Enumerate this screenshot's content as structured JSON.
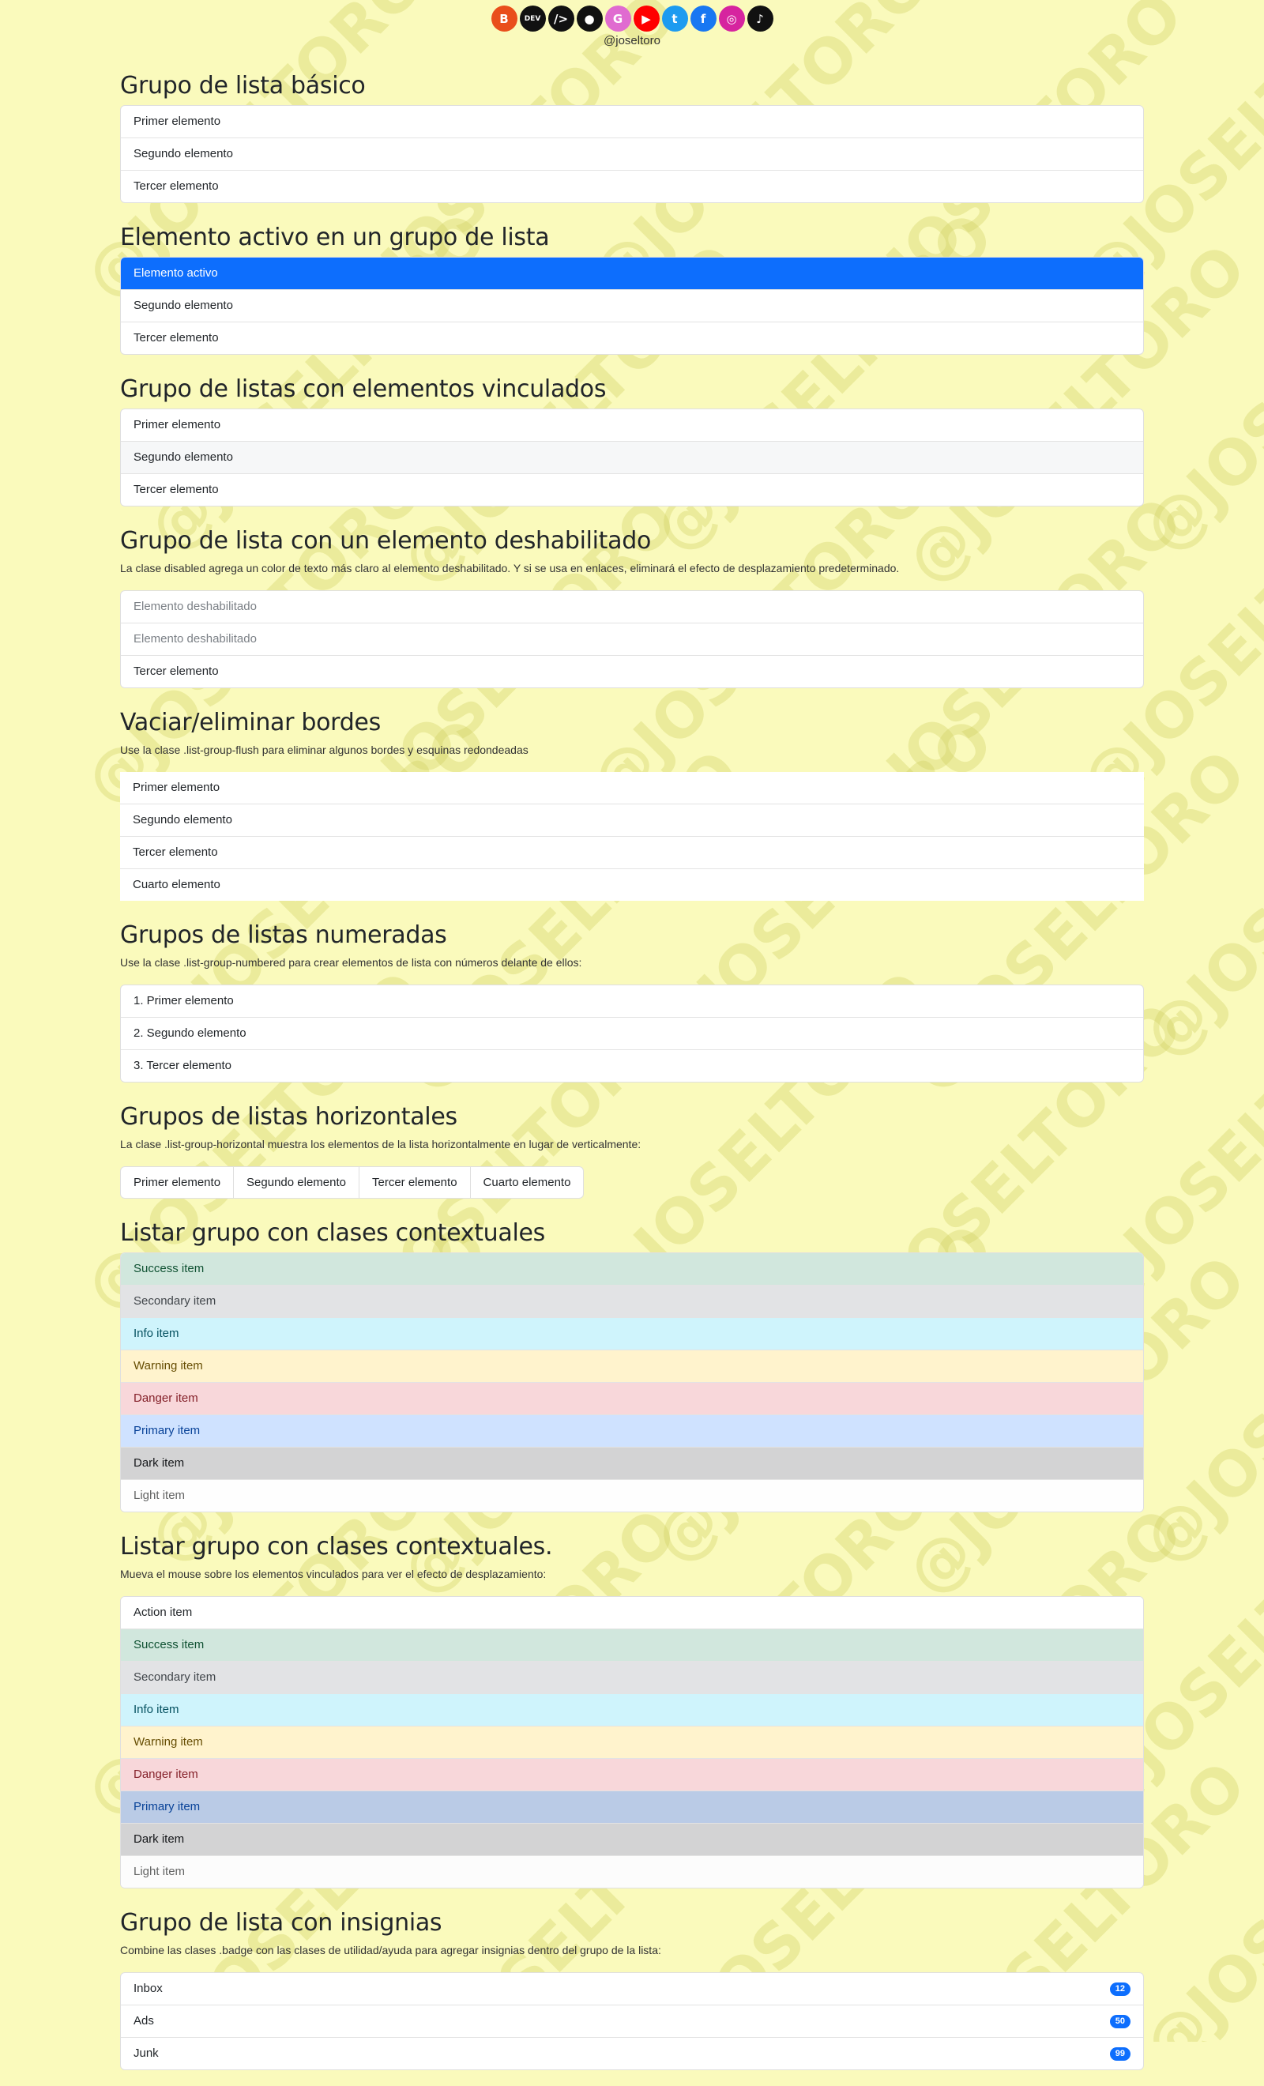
{
  "header": {
    "handle": "@joseltoro",
    "watermark": "@JOSELTORO",
    "social_icons": [
      {
        "name": "blogger-icon",
        "bg": "#e94e1b",
        "glyph": "B"
      },
      {
        "name": "dev-icon",
        "bg": "#111111",
        "glyph": "DEV"
      },
      {
        "name": "hashnode-icon",
        "bg": "#111111",
        "glyph": "/>"
      },
      {
        "name": "github-icon",
        "bg": "#111111",
        "glyph": "●"
      },
      {
        "name": "google-icon",
        "bg": "#e06bd0",
        "glyph": "G"
      },
      {
        "name": "youtube-icon",
        "bg": "#ff0000",
        "glyph": "▶"
      },
      {
        "name": "twitter-icon",
        "bg": "#1d9bf0",
        "glyph": "t"
      },
      {
        "name": "facebook-icon",
        "bg": "#1877f2",
        "glyph": "f"
      },
      {
        "name": "instagram-icon",
        "bg": "#d6249f",
        "glyph": "◎"
      },
      {
        "name": "tiktok-icon",
        "bg": "#111111",
        "glyph": "♪"
      }
    ]
  },
  "sections": {
    "basic": {
      "title": "Grupo de lista básico",
      "items": [
        "Primer elemento",
        "Segundo elemento",
        "Tercer elemento"
      ]
    },
    "active": {
      "title": "Elemento activo en un grupo de lista",
      "items": [
        "Elemento activo",
        "Segundo elemento",
        "Tercer elemento"
      ]
    },
    "linked": {
      "title": "Grupo de listas con elementos vinculados",
      "items": [
        "Primer elemento",
        "Segundo elemento",
        "Tercer elemento"
      ]
    },
    "disabled": {
      "title": "Grupo de lista con un elemento deshabilitado",
      "desc": "La clase disabled agrega un color de texto más claro al elemento deshabilitado. Y si se usa en enlaces, eliminará el efecto de desplazamiento predeterminado.",
      "items": [
        "Elemento deshabilitado",
        "Elemento deshabilitado",
        "Tercer elemento"
      ]
    },
    "flush": {
      "title": "Vaciar/eliminar bordes",
      "desc": "Use la clase .list-group-flush para eliminar algunos bordes y esquinas redondeadas",
      "items": [
        "Primer elemento",
        "Segundo elemento",
        "Tercer elemento",
        "Cuarto elemento"
      ]
    },
    "numbered": {
      "title": "Grupos de listas numeradas",
      "desc": "Use la clase .list-group-numbered para crear elementos de lista con números delante de ellos:",
      "items": [
        "1. Primer elemento",
        "2. Segundo elemento",
        "3. Tercer elemento"
      ]
    },
    "horizontal": {
      "title": "Grupos de listas horizontales",
      "desc": "La clase .list-group-horizontal muestra los elementos de la lista horizontalmente en lugar de verticalmente:",
      "items": [
        "Primer elemento",
        "Segundo elemento",
        "Tercer elemento",
        "Cuarto elemento"
      ]
    },
    "contextual": {
      "title": "Listar grupo con clases contextuales",
      "items": [
        {
          "label": "Success item",
          "bg": "#d1e7dd",
          "color": "#0f5132"
        },
        {
          "label": "Secondary item",
          "bg": "#e2e3e5",
          "color": "#41464b"
        },
        {
          "label": "Info item",
          "bg": "#cff4fc",
          "color": "#055160"
        },
        {
          "label": "Warning item",
          "bg": "#fff3cd",
          "color": "#664d03"
        },
        {
          "label": "Danger item",
          "bg": "#f8d7da",
          "color": "#842029"
        },
        {
          "label": "Primary item",
          "bg": "#cfe2ff",
          "color": "#084298"
        },
        {
          "label": "Dark item",
          "bg": "#d3d3d4",
          "color": "#141619"
        },
        {
          "label": "Light item",
          "bg": "#fefefe",
          "color": "#636464"
        }
      ]
    },
    "contextual_links": {
      "title": "Listar grupo con clases contextuales.",
      "desc": "Mueva el mouse sobre los elementos vinculados para ver el efecto de desplazamiento:",
      "items": [
        {
          "label": "Action item",
          "bg": "#ffffff",
          "color": "#212529"
        },
        {
          "label": "Success item",
          "bg": "#d1e7dd",
          "color": "#0f5132"
        },
        {
          "label": "Secondary item",
          "bg": "#e2e3e5",
          "color": "#41464b"
        },
        {
          "label": "Info item",
          "bg": "#cff4fc",
          "color": "#055160"
        },
        {
          "label": "Warning item",
          "bg": "#fff3cd",
          "color": "#664d03"
        },
        {
          "label": "Danger item",
          "bg": "#f8d7da",
          "color": "#842029"
        },
        {
          "label": "Primary item",
          "bg": "#bacbe6",
          "color": "#084298"
        },
        {
          "label": "Dark item",
          "bg": "#d3d3d4",
          "color": "#141619"
        },
        {
          "label": "Light item",
          "bg": "#fcfcfc",
          "color": "#636464"
        }
      ]
    },
    "badges": {
      "title": "Grupo de lista con insignias",
      "desc": "Combine las clases .badge con las clases de utilidad/ayuda para agregar insignias dentro del grupo de la lista:",
      "items": [
        {
          "label": "Inbox",
          "badge": "12"
        },
        {
          "label": "Ads",
          "badge": "50"
        },
        {
          "label": "Junk",
          "badge": "99"
        }
      ]
    }
  },
  "colors": {
    "page_bg": "#fafabc",
    "primary": "#0d6efd",
    "watermark": "#cdcd5f"
  }
}
